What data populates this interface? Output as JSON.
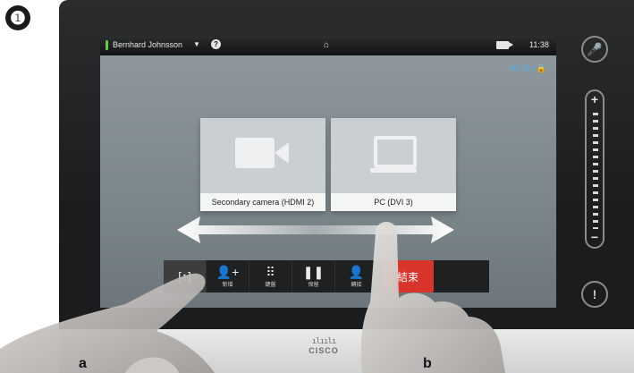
{
  "step_badge": "❶",
  "topbar": {
    "caller_name": "Bernhard Johnsson",
    "caret": "▼",
    "help": "?",
    "home": "⌂",
    "time": "11:38"
  },
  "call": {
    "duration": "00:33 | 🔒"
  },
  "sources": [
    {
      "label": "Secondary camera (HDMI 2)",
      "icon": "video-camera-icon"
    },
    {
      "label": "PC (DVI 3)",
      "icon": "laptop-icon"
    }
  ],
  "toolbar": {
    "share_glyph": "[↑]",
    "items": [
      {
        "glyph": "👤+",
        "label": "新增"
      },
      {
        "glyph": "⠿",
        "label": "鍵盤"
      },
      {
        "glyph": "❚❚",
        "label": "保留"
      },
      {
        "glyph": "👤",
        "label": "轉接"
      }
    ],
    "end_label": "結束"
  },
  "side": {
    "mute": "🎤",
    "volume_plus": "+",
    "volume_minus": "−",
    "alert": "!"
  },
  "brand": {
    "bars": "ılıılı",
    "word": "CISCO"
  },
  "callouts": {
    "left": "a",
    "right": "b"
  },
  "colors": {
    "end_call": "#d9342b",
    "duration_text": "#4fb1f2",
    "status_led": "#5fcf3b"
  }
}
